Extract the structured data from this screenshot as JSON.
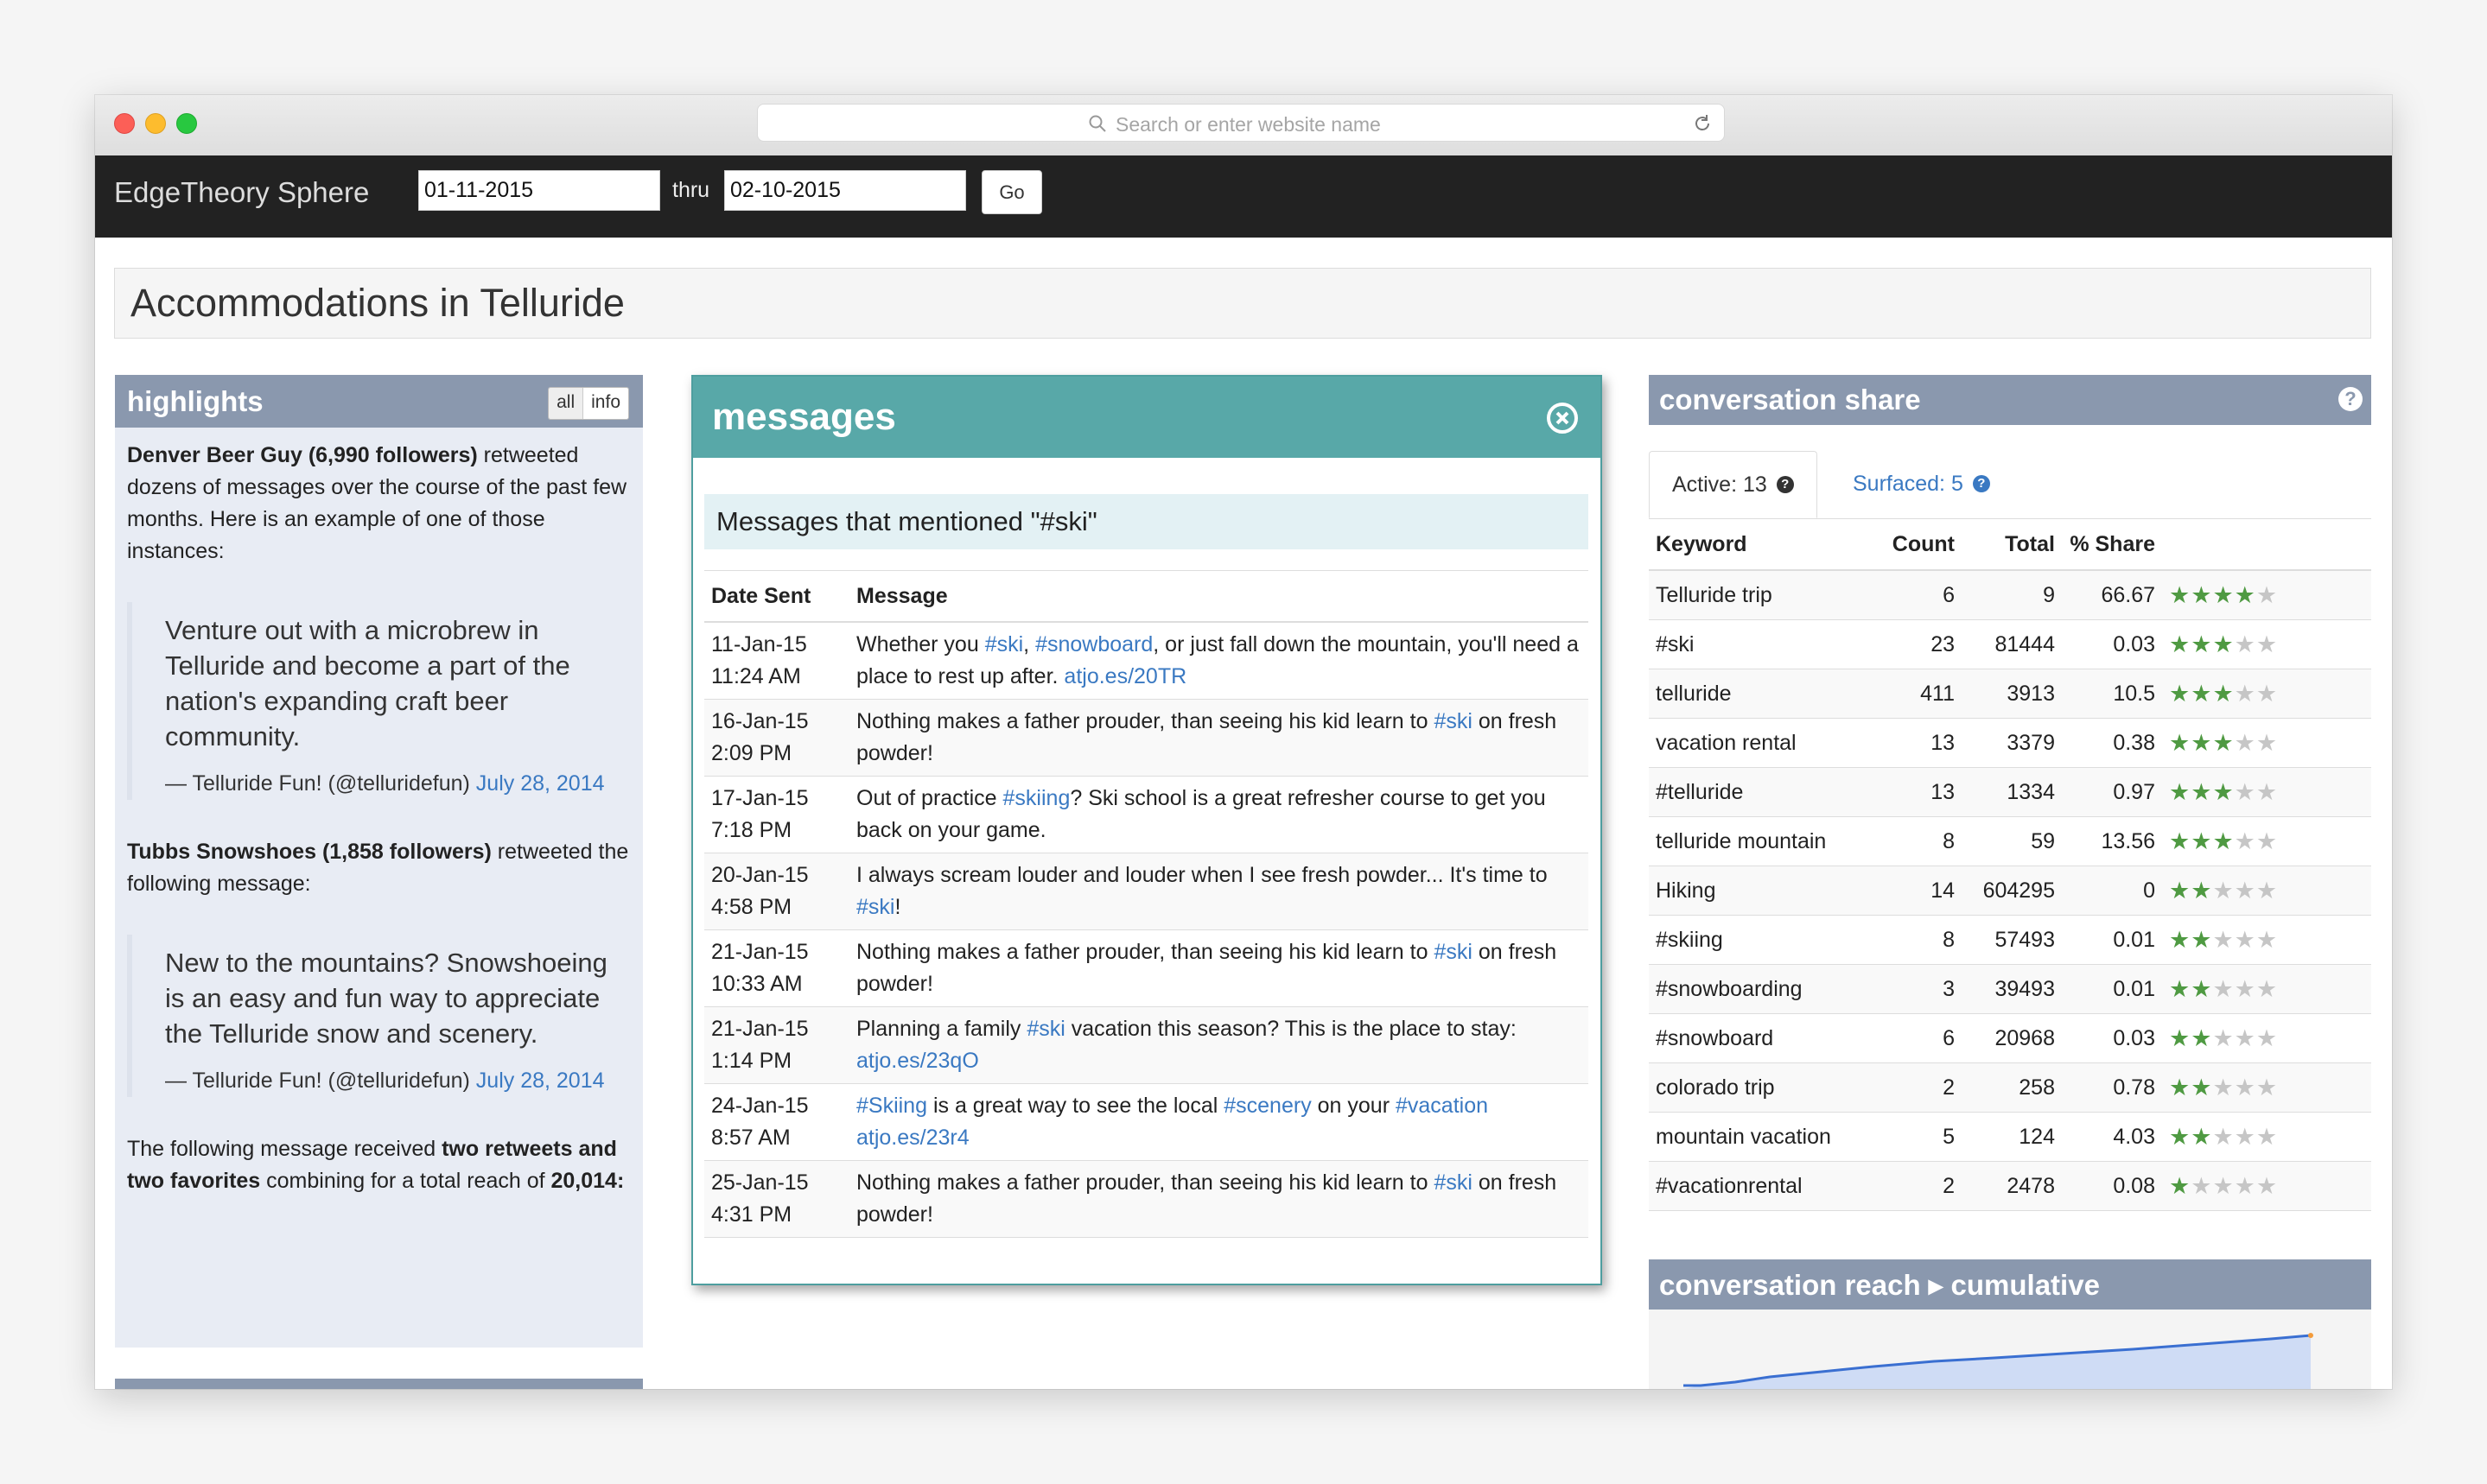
{
  "browser": {
    "url_placeholder": "Search or enter website name"
  },
  "navbar": {
    "brand": "EdgeTheory Sphere",
    "date_from": "01-11-2015",
    "thru_label": "thru",
    "date_to": "02-10-2015",
    "go_label": "Go"
  },
  "page": {
    "title": "Accommodations in Telluride"
  },
  "highlights": {
    "title": "highlights",
    "filter_all": "all",
    "filter_info": "info",
    "item1_bold": "Denver Beer Guy (6,990 followers)",
    "item1_rest": " retweeted dozens of messages over the course of the past few months. Here is an example of one of those instances:",
    "quote1": "Venture out with a microbrew in Telluride and become a part of the nation's expanding craft beer community.",
    "quote1_author": "— Telluride Fun! (@telluridefun) ",
    "quote1_date": "July 28, 2014",
    "item2_bold": "Tubbs Snowshoes (1,858 followers)",
    "item2_rest": " retweeted the following message:",
    "quote2": "New to the mountains? Snowshoeing is an easy and fun way to appreciate the Telluride snow and scenery.",
    "quote2_author": "— Telluride Fun! (@telluridefun) ",
    "quote2_date": "July 28, 2014",
    "item3_a": "The following message received ",
    "item3_b": "two retweets and two favorites",
    "item3_c": " combining for a total reach of ",
    "item3_d": "20,014",
    "item3_e": ":"
  },
  "messages": {
    "title": "messages",
    "subheader": "Messages that mentioned \"#ski\"",
    "col_date": "Date Sent",
    "col_message": "Message",
    "rows": [
      {
        "date": "11-Jan-15",
        "time": "11:24 AM",
        "parts": [
          {
            "t": "Whether you ",
            "l": false
          },
          {
            "t": "#ski",
            "l": true
          },
          {
            "t": ", ",
            "l": false
          },
          {
            "t": "#snowboard",
            "l": true
          },
          {
            "t": ", or just fall down the mountain, you'll need a place to rest up after. ",
            "l": false
          },
          {
            "t": "atjo.es/20TR",
            "l": true
          }
        ]
      },
      {
        "date": "16-Jan-15",
        "time": "2:09 PM",
        "parts": [
          {
            "t": "Nothing makes a father prouder, than seeing his kid learn to ",
            "l": false
          },
          {
            "t": "#ski",
            "l": true
          },
          {
            "t": " on fresh powder!",
            "l": false
          }
        ]
      },
      {
        "date": "17-Jan-15",
        "time": "7:18 PM",
        "parts": [
          {
            "t": "Out of practice ",
            "l": false
          },
          {
            "t": "#skiing",
            "l": true
          },
          {
            "t": "? Ski school is a great refresher course to get you back on your game.",
            "l": false
          }
        ]
      },
      {
        "date": "20-Jan-15",
        "time": "4:58 PM",
        "parts": [
          {
            "t": "I always scream louder and louder when I see fresh powder... It's time to ",
            "l": false
          },
          {
            "t": "#ski",
            "l": true
          },
          {
            "t": "!",
            "l": false
          }
        ]
      },
      {
        "date": "21-Jan-15",
        "time": "10:33 AM",
        "parts": [
          {
            "t": "Nothing makes a father prouder, than seeing his kid learn to ",
            "l": false
          },
          {
            "t": "#ski",
            "l": true
          },
          {
            "t": " on fresh powder!",
            "l": false
          }
        ]
      },
      {
        "date": "21-Jan-15",
        "time": "1:14 PM",
        "parts": [
          {
            "t": "Planning a family ",
            "l": false
          },
          {
            "t": "#ski",
            "l": true
          },
          {
            "t": " vacation this season? This is the place to stay: ",
            "l": false
          },
          {
            "t": "atjo.es/23qO",
            "l": true
          }
        ]
      },
      {
        "date": "24-Jan-15",
        "time": "8:57 AM",
        "parts": [
          {
            "t": "#Skiing",
            "l": true
          },
          {
            "t": " is a great way to see the local ",
            "l": false
          },
          {
            "t": "#scenery",
            "l": true
          },
          {
            "t": " on your ",
            "l": false
          },
          {
            "t": "#vacation",
            "l": true
          },
          {
            "t": " ",
            "l": false
          },
          {
            "t": "atjo.es/23r4",
            "l": true
          }
        ]
      },
      {
        "date": "25-Jan-15",
        "time": "4:31 PM",
        "parts": [
          {
            "t": "Nothing makes a father prouder, than seeing his kid learn to ",
            "l": false
          },
          {
            "t": "#ski",
            "l": true
          },
          {
            "t": " on fresh powder!",
            "l": false
          }
        ]
      }
    ]
  },
  "conversation_share": {
    "title": "conversation share",
    "tab_active_label": "Active: 13",
    "tab_surfaced_label": "Surfaced: 5",
    "col_keyword": "Keyword",
    "col_count": "Count",
    "col_total": "Total",
    "col_share": "% Share",
    "rows": [
      {
        "keyword": "Telluride trip",
        "count": "6",
        "total": "9",
        "share": "66.67",
        "stars": 4
      },
      {
        "keyword": "#ski",
        "count": "23",
        "total": "81444",
        "share": "0.03",
        "stars": 3
      },
      {
        "keyword": "telluride",
        "count": "411",
        "total": "3913",
        "share": "10.5",
        "stars": 3
      },
      {
        "keyword": "vacation rental",
        "count": "13",
        "total": "3379",
        "share": "0.38",
        "stars": 3
      },
      {
        "keyword": "#telluride",
        "count": "13",
        "total": "1334",
        "share": "0.97",
        "stars": 3
      },
      {
        "keyword": "telluride mountain",
        "count": "8",
        "total": "59",
        "share": "13.56",
        "stars": 3
      },
      {
        "keyword": "Hiking",
        "count": "14",
        "total": "604295",
        "share": "0",
        "stars": 2
      },
      {
        "keyword": "#skiing",
        "count": "8",
        "total": "57493",
        "share": "0.01",
        "stars": 2
      },
      {
        "keyword": "#snowboarding",
        "count": "3",
        "total": "39493",
        "share": "0.01",
        "stars": 2
      },
      {
        "keyword": "#snowboard",
        "count": "6",
        "total": "20968",
        "share": "0.03",
        "stars": 2
      },
      {
        "keyword": "colorado trip",
        "count": "2",
        "total": "258",
        "share": "0.78",
        "stars": 2
      },
      {
        "keyword": "mountain vacation",
        "count": "5",
        "total": "124",
        "share": "4.03",
        "stars": 2
      },
      {
        "keyword": "#vacationrental",
        "count": "2",
        "total": "2478",
        "share": "0.08",
        "stars": 1
      }
    ]
  },
  "conversation_reach": {
    "title": "conversation reach ▸ cumulative"
  },
  "colors": {
    "accent_teal": "#58a8a8",
    "panel_header": "#8a98ae",
    "link": "#3a79c2",
    "star_on": "#4f9a42"
  }
}
